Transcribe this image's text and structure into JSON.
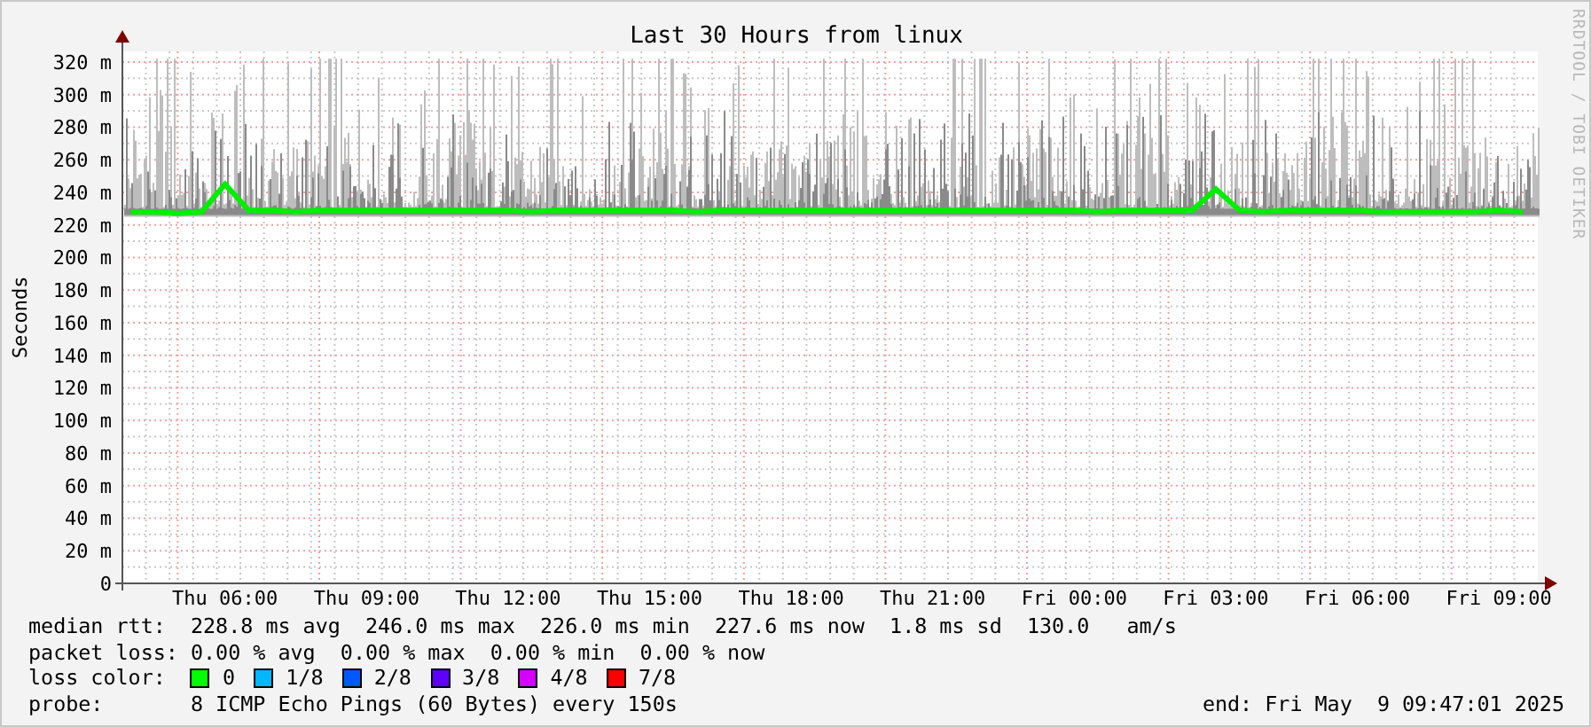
{
  "credit": "RRDTOOL / TOBI OETIKER",
  "chart": {
    "chart_data": {
      "type": "line",
      "title": "Last 30 Hours from linux",
      "ylabel": "Seconds",
      "grid": true,
      "ylim": [
        0,
        326.5
      ],
      "categories": [
        null,
        null,
        null,
        null,
        "Thu 06:00",
        null,
        null,
        null,
        null,
        null,
        "Thu 09:00",
        null,
        null,
        null,
        null,
        null,
        "Thu 12:00",
        null,
        null,
        null,
        null,
        null,
        "Thu 15:00",
        null,
        null,
        null,
        null,
        null,
        "Thu 18:00",
        null,
        null,
        null,
        null,
        null,
        "Thu 21:00",
        null,
        null,
        null,
        null,
        null,
        "Fri 00:00",
        null,
        null,
        null,
        null,
        null,
        "Fri 03:00",
        null,
        null,
        null,
        null,
        null,
        "Fri 06:00",
        null,
        null,
        null,
        null,
        null,
        "Fri 09:00",
        null
      ],
      "yticks": [
        {
          "value": 0,
          "label": "0"
        },
        {
          "value": 20,
          "label": "20 m"
        },
        {
          "value": 40,
          "label": "40 m"
        },
        {
          "value": 60,
          "label": "60 m"
        },
        {
          "value": 80,
          "label": "80 m"
        },
        {
          "value": 100,
          "label": "100 m"
        },
        {
          "value": 120,
          "label": "120 m"
        },
        {
          "value": 140,
          "label": "140 m"
        },
        {
          "value": 160,
          "label": "160 m"
        },
        {
          "value": 180,
          "label": "180 m"
        },
        {
          "value": 200,
          "label": "200 m"
        },
        {
          "value": 220,
          "label": "220 m"
        },
        {
          "value": 240,
          "label": "240 m"
        },
        {
          "value": 260,
          "label": "260 m"
        },
        {
          "value": 280,
          "label": "280 m"
        },
        {
          "value": 300,
          "label": "300 m"
        },
        {
          "value": 320,
          "label": "320 m"
        }
      ],
      "series": [
        {
          "color": "#00ee00",
          "values": [
            228,
            228,
            227,
            228,
            245,
            229,
            229,
            228,
            229,
            229,
            229,
            229,
            229,
            229,
            229,
            229,
            229,
            228,
            229,
            229,
            229,
            229,
            229,
            229,
            228,
            229,
            229,
            229,
            229,
            229,
            229,
            229,
            229,
            229,
            229,
            229,
            229,
            229,
            229,
            229,
            229,
            228,
            229,
            229,
            229,
            229,
            242,
            229,
            228,
            229,
            229,
            229,
            229,
            228,
            228,
            228,
            228,
            228,
            229,
            228
          ]
        }
      ]
    }
  },
  "legend": {
    "median_rtt": {
      "label": "median rtt:",
      "items": [
        "228.8 ms avg",
        "246.0 ms max",
        "226.0 ms min",
        "227.6 ms now",
        "1.8 ms sd",
        "130.0   am/s"
      ]
    },
    "packet_loss": {
      "label": "packet loss:",
      "items": [
        "0.00 % avg",
        "0.00 % max",
        "0.00 % min",
        "0.00 % now"
      ]
    },
    "loss_color": {
      "label": "loss color:",
      "items": [
        {
          "label": "0",
          "color": "#00ff00"
        },
        {
          "label": "1/8",
          "color": "#00b8ff"
        },
        {
          "label": "2/8",
          "color": "#0059ff"
        },
        {
          "label": "3/8",
          "color": "#5e00ff"
        },
        {
          "label": "4/8",
          "color": "#d600ff"
        },
        {
          "label": "7/8",
          "color": "#ff0000"
        }
      ]
    },
    "probe": {
      "label": "probe:",
      "value": "8 ICMP Echo Pings (60 Bytes) every 150s",
      "end": "end: Fri May  9 09:47:01 2025"
    }
  }
}
